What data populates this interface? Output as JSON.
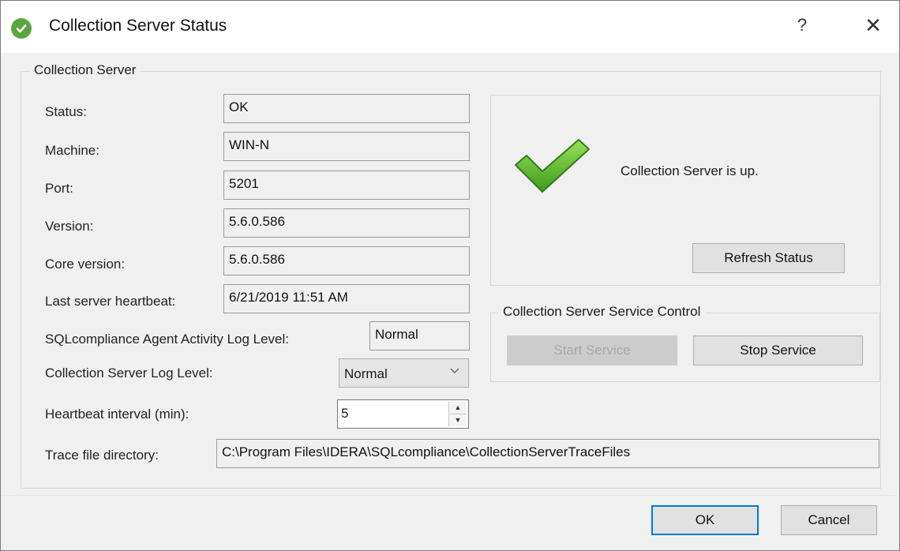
{
  "window": {
    "title": "Collection Server Status",
    "help_glyph": "?",
    "close_glyph": "✕"
  },
  "group": {
    "legend": "Collection Server"
  },
  "fields": {
    "status": {
      "label": "Status:",
      "value": "OK"
    },
    "machine": {
      "label": "Machine:",
      "value": "WIN-N"
    },
    "port": {
      "label": "Port:",
      "value": "5201"
    },
    "version": {
      "label": "Version:",
      "value": "5.6.0.586"
    },
    "core_version": {
      "label": "Core version:",
      "value": "5.6.0.586"
    },
    "heartbeat": {
      "label": "Last server heartbeat:",
      "value": "6/21/2019 11:51 AM"
    },
    "agent_log_level": {
      "label": "SQLcompliance Agent Activity Log Level:",
      "value": "Normal"
    },
    "server_log_level": {
      "label": "Collection Server Log Level:",
      "value": "Normal"
    },
    "heartbeat_interval": {
      "label": "Heartbeat interval (min):",
      "value": "5"
    },
    "trace_dir": {
      "label": "Trace file directory:",
      "value": "C:\\Program Files\\IDERA\\SQLcompliance\\CollectionServerTraceFiles"
    }
  },
  "status_panel": {
    "message": "Collection Server is up.",
    "refresh_label": "Refresh Status"
  },
  "service_control": {
    "legend": "Collection Server Service Control",
    "start_label": "Start Service",
    "stop_label": "Stop Service"
  },
  "buttons": {
    "ok": "OK",
    "cancel": "Cancel"
  },
  "colors": {
    "accent": "#0078d7",
    "success": "#5aa63e"
  },
  "icons": {
    "title": "check-circle-icon",
    "status": "checkmark-icon",
    "combo": "chevron-down-icon",
    "spin_up": "arrow-up-icon",
    "spin_down": "arrow-down-icon"
  }
}
